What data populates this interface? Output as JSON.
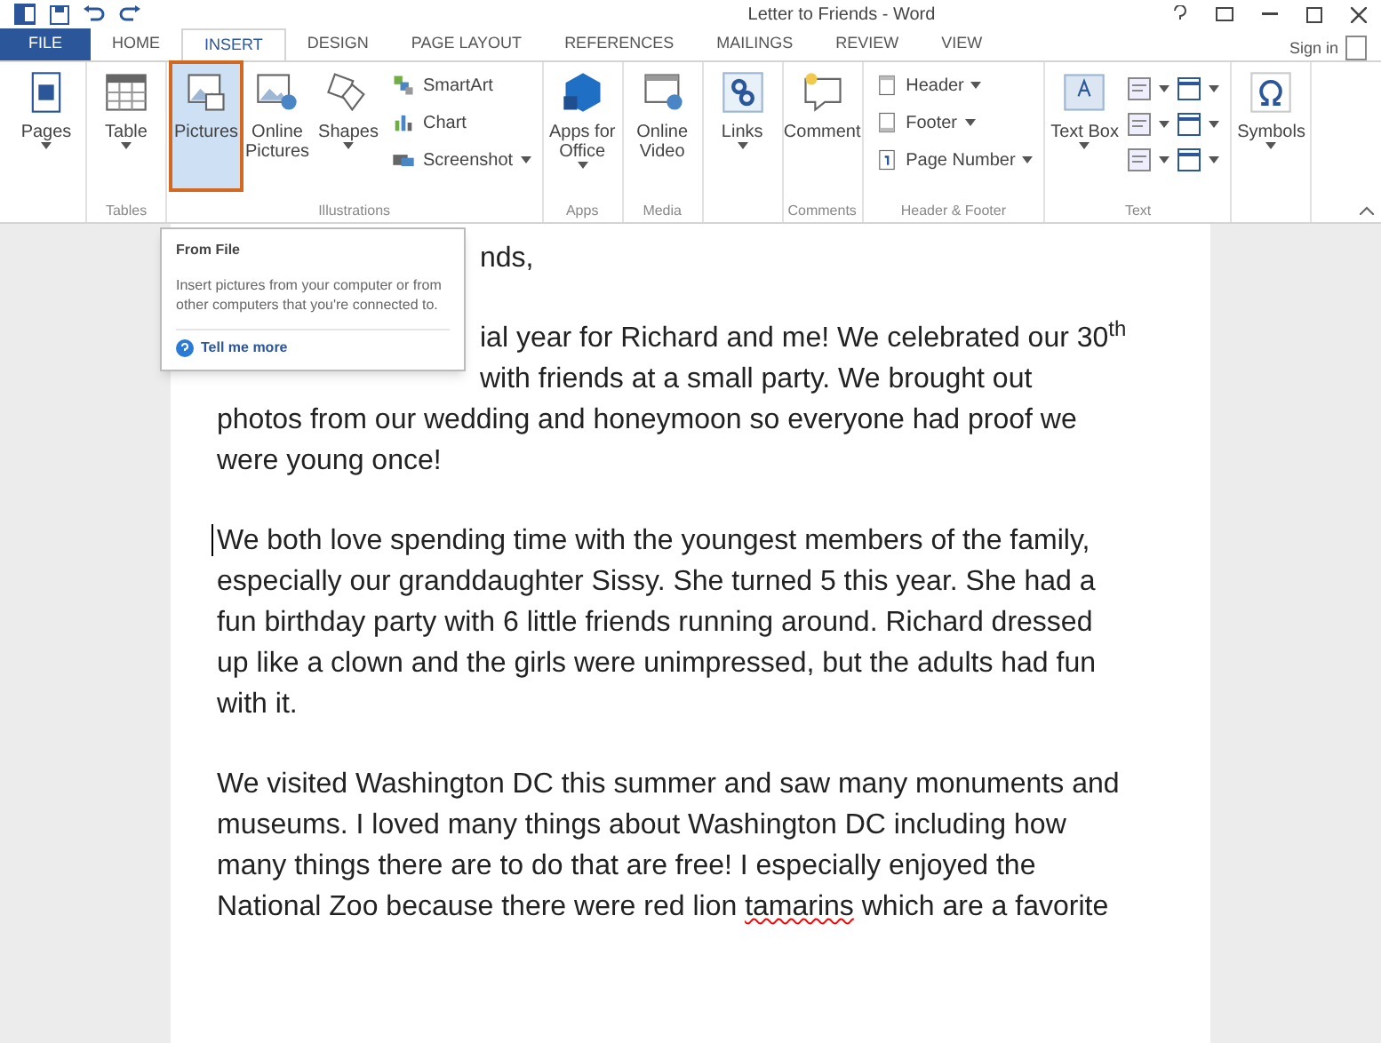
{
  "window": {
    "title": "Letter to Friends - Word",
    "sign_in": "Sign in"
  },
  "tabs": [
    {
      "label": "FILE",
      "kind": "file",
      "selected": false
    },
    {
      "label": "HOME",
      "kind": "tab",
      "selected": false
    },
    {
      "label": "INSERT",
      "kind": "tab",
      "selected": true
    },
    {
      "label": "DESIGN",
      "kind": "tab",
      "selected": false
    },
    {
      "label": "PAGE LAYOUT",
      "kind": "tab",
      "selected": false
    },
    {
      "label": "REFERENCES",
      "kind": "tab",
      "selected": false
    },
    {
      "label": "MAILINGS",
      "kind": "tab",
      "selected": false
    },
    {
      "label": "REVIEW",
      "kind": "tab",
      "selected": false
    },
    {
      "label": "VIEW",
      "kind": "tab",
      "selected": false
    }
  ],
  "ribbon": {
    "groups": [
      {
        "buttons": [
          {
            "label": "Pages",
            "kind": "large",
            "selected": false,
            "dropdown": true
          }
        ]
      },
      {
        "label": "Tables",
        "buttons": [
          {
            "label": "Table",
            "kind": "large",
            "selected": false,
            "dropdown": true
          }
        ]
      },
      {
        "label": "Illustrations",
        "buttons": [
          {
            "label": "Pictures",
            "kind": "large",
            "selected": true,
            "dropdown": false
          },
          {
            "label": "Online Pictures",
            "kind": "large",
            "selected": false,
            "dropdown": false
          },
          {
            "label": "Shapes",
            "kind": "large",
            "selected": false,
            "dropdown": true
          },
          {
            "kind": "stack",
            "items": [
              {
                "label": "SmartArt",
                "dropdown": false
              },
              {
                "label": "Chart",
                "dropdown": false
              },
              {
                "label": "Screenshot",
                "dropdown": true
              }
            ]
          }
        ]
      },
      {
        "label": "Apps",
        "buttons": [
          {
            "label": "Apps for Office",
            "kind": "large",
            "selected": false,
            "dropdown": true
          }
        ]
      },
      {
        "label": "Media",
        "buttons": [
          {
            "label": "Online Video",
            "kind": "large",
            "selected": false,
            "dropdown": false
          }
        ]
      },
      {
        "buttons": [
          {
            "label": "Links",
            "kind": "large",
            "selected": false,
            "dropdown": true
          }
        ]
      },
      {
        "label": "Comments",
        "buttons": [
          {
            "label": "Comment",
            "kind": "large",
            "selected": false,
            "dropdown": false
          }
        ]
      },
      {
        "label": "Header & Footer",
        "buttons": [
          {
            "kind": "stack",
            "items": [
              {
                "label": "Header",
                "dropdown": true
              },
              {
                "label": "Footer",
                "dropdown": true
              },
              {
                "label": "Page Number",
                "dropdown": true
              }
            ]
          }
        ]
      },
      {
        "label": "Text",
        "buttons": [
          {
            "label": "Text Box",
            "kind": "large",
            "selected": false,
            "dropdown": true
          },
          {
            "kind": "icons"
          }
        ]
      },
      {
        "buttons": [
          {
            "label": "Symbols",
            "kind": "large",
            "selected": false,
            "dropdown": true
          }
        ]
      }
    ]
  },
  "tooltip": {
    "title": "From File",
    "description": "Insert pictures from your computer or from other computers that you're connected to.",
    "link": "Tell me more"
  },
  "document": {
    "paragraphs": [
      {
        "cursor": false,
        "lines": [
          {
            "text": "nds,",
            "covered": true
          }
        ]
      },
      {
        "cursor": false,
        "lines": [
          {
            "text": "ial year for Richard and me! We celebrated our 30$^{th}$",
            "covered": true
          },
          {
            "text": "with friends at a small party.  We brought out",
            "covered": true
          },
          {
            "text": "photos from our wedding and honeymoon so everyone had proof we"
          },
          {
            "text": "were young once!"
          }
        ]
      },
      {
        "cursor": true,
        "lines": [
          {
            "text": "We both love spending time with the youngest members of the family,"
          },
          {
            "text": "especially our granddaughter Sissy.  She turned 5 this year.  She had a"
          },
          {
            "text": "fun birthday party with 6 little friends running around.  Richard dressed"
          },
          {
            "text": "up like a clown and the girls were unimpressed, but the adults had fun"
          },
          {
            "text": "with it."
          }
        ]
      },
      {
        "cursor": false,
        "lines": [
          {
            "text": "We visited Washington DC this summer and saw many monuments and"
          },
          {
            "text": "museums.  I loved many things about Washington DC including how"
          },
          {
            "text": "many things there are to do that are free!  I especially enjoyed the"
          },
          {
            "segments": [
              {
                "text": "National Zoo because there were red lion ",
                "misspelled": false
              },
              {
                "text": "tamarins",
                "misspelled": true
              },
              {
                "text": " which are a favorite",
                "misspelled": false
              }
            ]
          }
        ]
      }
    ]
  }
}
